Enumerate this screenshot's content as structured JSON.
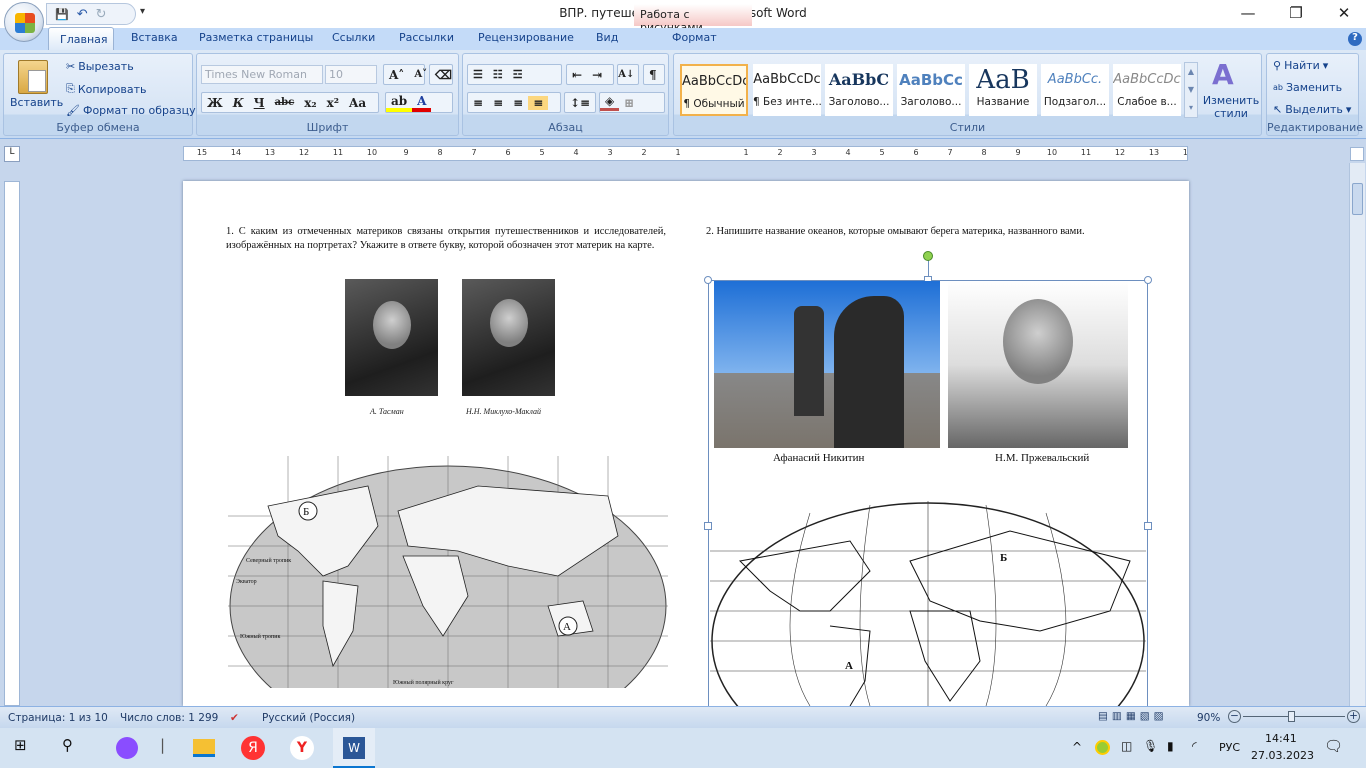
{
  "window": {
    "title": "ВПР. путешественники - Microsoft Word",
    "context_tab_group": "Работа с рисунками",
    "minimize": "—",
    "restore": "❐",
    "close": "✕"
  },
  "qat": {
    "save": "💾",
    "undo": "↶",
    "redo": "↻",
    "customize": "▾"
  },
  "tabs": [
    "Главная",
    "Вставка",
    "Разметка страницы",
    "Ссылки",
    "Рассылки",
    "Рецензирование",
    "Вид",
    "Формат"
  ],
  "ribbon": {
    "clipboard": {
      "label": "Буфер обмена",
      "paste": "Вставить",
      "cut": "Вырезать",
      "copy": "Копировать",
      "format_painter": "Формат по образцу"
    },
    "font": {
      "label": "Шрифт",
      "font_name": "Times New Roman",
      "font_size": "10",
      "bold": "Ж",
      "italic": "К",
      "underline": "Ч",
      "strike": "abc",
      "subscript": "x₂",
      "superscript": "x²",
      "change_case": "Aa",
      "grow": "A˄",
      "shrink": "A˅",
      "highlight_color": "#ffff00",
      "font_color": "#e00000"
    },
    "paragraph": {
      "label": "Абзац",
      "pilcrow": "¶",
      "sort": "А↓"
    },
    "styles": {
      "label": "Стили",
      "items": [
        {
          "preview": "AaBbCcDc",
          "name": "¶ Обычный",
          "selected": true
        },
        {
          "preview": "AaBbCcDc",
          "name": "¶ Без инте..."
        },
        {
          "preview": "AaBbC",
          "name": "Заголово..."
        },
        {
          "preview": "AaBbCc",
          "name": "Заголово..."
        },
        {
          "preview": "AaB",
          "name": "Название"
        },
        {
          "preview": "AaBbCc.",
          "name": "Подзагол..."
        },
        {
          "preview": "AaBbCcDc",
          "name": "Слабое в..."
        }
      ],
      "change_styles": "Изменить стили"
    },
    "editing": {
      "label": "Редактирование",
      "find": "Найти",
      "replace": "Заменить",
      "select": "Выделить"
    }
  },
  "ruler": {
    "numbers": [
      "15",
      "14",
      "13",
      "12",
      "11",
      "10",
      "9",
      "8",
      "7",
      "6",
      "5",
      "4",
      "3",
      "2",
      "1",
      "",
      "1",
      "2",
      "3",
      "4",
      "5",
      "6",
      "7",
      "8",
      "9",
      "10",
      "11",
      "12",
      "13",
      "14"
    ]
  },
  "document": {
    "q1": "1. С каким из отмеченных материков связаны открытия путешественников и исследователей, изображённых на портретах? Укажите в ответе букву, которой обозначен этот материк на карте.",
    "q2": "2. Напишите название океанов,  которые омывают берега материка, названного вами.",
    "portraits1": [
      "А. Тасман",
      "Н.Н. Миклухо-Маклай"
    ],
    "portraits2": [
      "Афанасий Никитин",
      "Н.М. Пржевальский"
    ],
    "map1_labels": {
      "b": "Б",
      "a": "А",
      "north_tropic": "Северный тропик",
      "equator": "Экватор",
      "south_tropic": "Южный тропик",
      "south_polar": "Южный полярный круг"
    },
    "map2_labels": {
      "b": "Б",
      "a": "А"
    }
  },
  "status": {
    "page": "Страница: 1 из 10",
    "words": "Число слов: 1 299",
    "language": "Русский (Россия)",
    "zoom": "90%",
    "zoom_percent": 90
  },
  "taskbar": {
    "lang": "РУС",
    "time": "14:41",
    "date": "27.03.2023"
  }
}
